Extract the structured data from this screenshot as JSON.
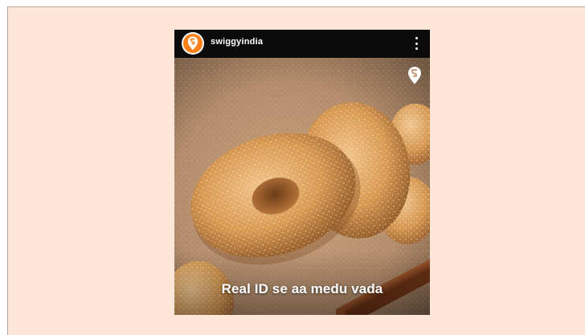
{
  "post": {
    "username": "swiggyindia",
    "caption": "Real ID se aa medu vada"
  },
  "icons": {
    "avatar": "swiggy-logo-icon",
    "menu": "more-options-icon",
    "watermark": "swiggy-watermark-icon"
  },
  "colors": {
    "background": "#fde5d8",
    "header": "#0b0b0b",
    "brand": "#fc8019",
    "caption": "#ffffff"
  }
}
